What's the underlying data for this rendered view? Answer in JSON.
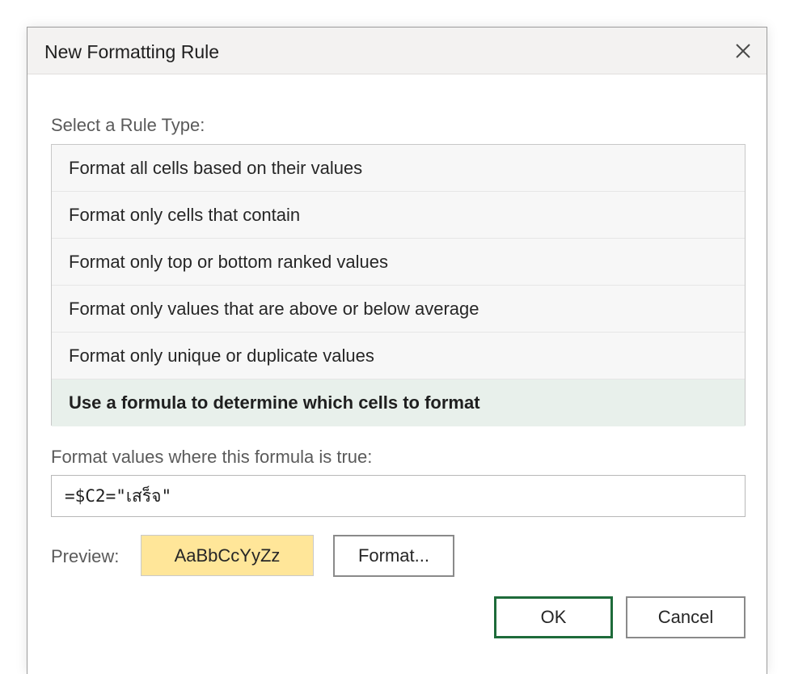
{
  "dialog": {
    "title": "New Formatting Rule",
    "close_icon": "close-icon"
  },
  "rule_type": {
    "label": "Select a Rule Type:",
    "items": [
      {
        "label": "Format all cells based on their values",
        "selected": false
      },
      {
        "label": "Format only cells that contain",
        "selected": false
      },
      {
        "label": "Format only top or bottom ranked values",
        "selected": false
      },
      {
        "label": "Format only values that are above or below average",
        "selected": false
      },
      {
        "label": "Format only unique or duplicate values",
        "selected": false
      },
      {
        "label": "Use a formula to determine which cells to format",
        "selected": true
      }
    ]
  },
  "formula": {
    "label": "Format values where this formula is true:",
    "value": "=$C2=\"เสร็จ\""
  },
  "preview": {
    "label": "Preview:",
    "sample_text": "AaBbCcYyZz",
    "fill_color": "#ffe699"
  },
  "buttons": {
    "format": "Format...",
    "ok": "OK",
    "cancel": "Cancel"
  },
  "colors": {
    "accent": "#1e6b3a",
    "selected_row": "#e8f0eb",
    "title_bar": "#f3f2f1"
  }
}
